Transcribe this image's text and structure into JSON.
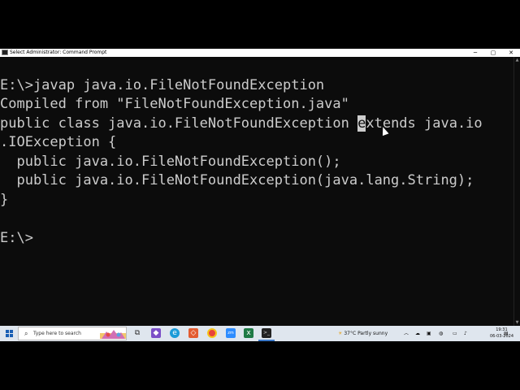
{
  "window": {
    "title": "Select Administrator: Command Prompt",
    "controls": {
      "minimize": "─",
      "maximize": "▢",
      "close": "✕"
    }
  },
  "console": {
    "lines": [
      "",
      "E:\\>javap java.io.FileNotFoundException",
      "Compiled from \"FileNotFoundException.java\"",
      "public class java.io.FileNotFoundException ",
      ".IOException {",
      "  public java.io.FileNotFoundException();",
      "  public java.io.FileNotFoundException(java.lang.String);",
      "}",
      "",
      "E:\\>"
    ],
    "cursor_char": "e",
    "line3_tail": "xtends java.io"
  },
  "taskbar": {
    "search_placeholder": "Type here to search",
    "weather_temp": "37°C",
    "weather_text": "Partly sunny",
    "time": "19:31",
    "date": "06-03-2024",
    "apps": [
      "task-view-icon",
      "visual-studio-icon",
      "edge-icon",
      "git-icon",
      "chrome-icon",
      "zoom-icon",
      "excel-icon",
      "command-prompt-icon"
    ]
  }
}
